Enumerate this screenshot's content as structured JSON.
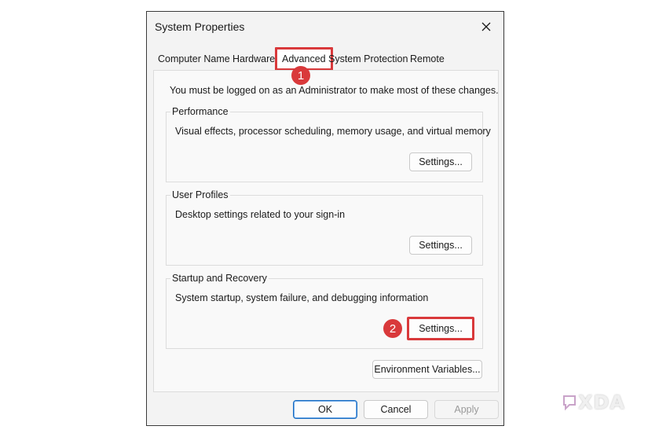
{
  "window": {
    "title": "System Properties",
    "close_icon": "close-icon"
  },
  "tabs": [
    {
      "label": "Computer Name",
      "active": false
    },
    {
      "label": "Hardware",
      "active": false
    },
    {
      "label": "Advanced",
      "active": true
    },
    {
      "label": "System Protection",
      "active": false
    },
    {
      "label": "Remote",
      "active": false
    }
  ],
  "panel": {
    "notice": "You must be logged on as an Administrator to make most of these changes.",
    "performance": {
      "label": "Performance",
      "description": "Visual effects, processor scheduling, memory usage, and virtual memory",
      "button": "Settings..."
    },
    "user_profiles": {
      "label": "User Profiles",
      "description": "Desktop settings related to your sign-in",
      "button": "Settings..."
    },
    "startup_recovery": {
      "label": "Startup and Recovery",
      "description": "System startup, system failure, and debugging information",
      "button": "Settings..."
    },
    "env_button": "Environment Variables..."
  },
  "annotations": {
    "step1": "1",
    "step2": "2",
    "color": "#d9393b"
  },
  "footer": {
    "ok": "OK",
    "cancel": "Cancel",
    "apply": "Apply"
  },
  "watermark": {
    "text": "XDA",
    "logo_icon": "xda-logo-icon"
  }
}
